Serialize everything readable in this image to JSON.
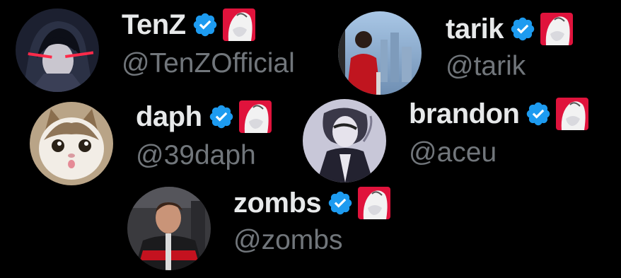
{
  "accent_verified": "#1d9bf0",
  "badge_color": "#e0133c",
  "accounts": [
    {
      "display_name": "TenZ",
      "handle": "@TenZOfficial",
      "avatar": "anime-character-avatar"
    },
    {
      "display_name": "tarik",
      "handle": "@tarik",
      "avatar": "person-at-window-avatar"
    },
    {
      "display_name": "daph",
      "handle": "@39daph",
      "avatar": "cat-avatar"
    },
    {
      "display_name": "brandon",
      "handle": "@aceu",
      "avatar": "sketch-portrait-avatar"
    },
    {
      "display_name": "zombs",
      "handle": "@zombs",
      "avatar": "man-in-jacket-avatar"
    }
  ]
}
